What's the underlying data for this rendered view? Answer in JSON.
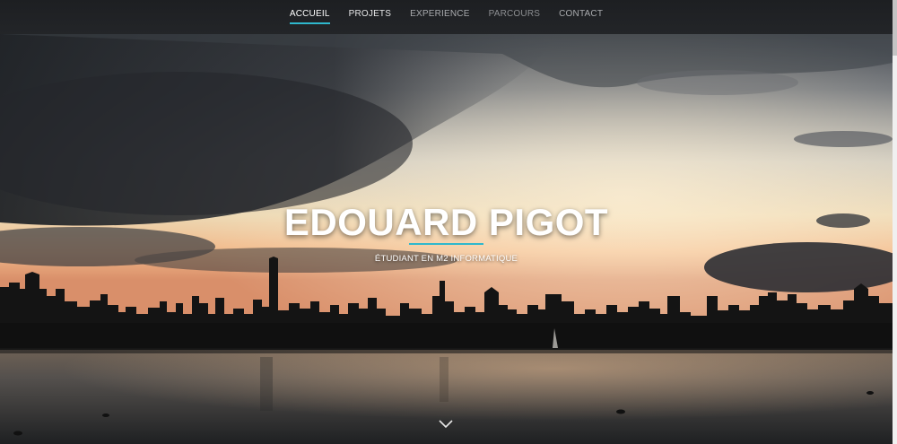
{
  "nav": {
    "items": [
      {
        "label": "ACCUEIL",
        "state": "active"
      },
      {
        "label": "PROJETS",
        "state": "bright"
      },
      {
        "label": "EXPERIENCE",
        "state": "normal"
      },
      {
        "label": "PARCOURS",
        "state": "dim"
      },
      {
        "label": "CONTACT",
        "state": "normal"
      }
    ]
  },
  "hero": {
    "title": "EDOUARD PIGOT",
    "subtitle": "ÉTUDIANT EN M2 INFORMATIQUE",
    "scroll_icon": "chevron-down-icon"
  },
  "colors": {
    "accent": "#2fb8cd",
    "navbar": "#1f2124"
  }
}
